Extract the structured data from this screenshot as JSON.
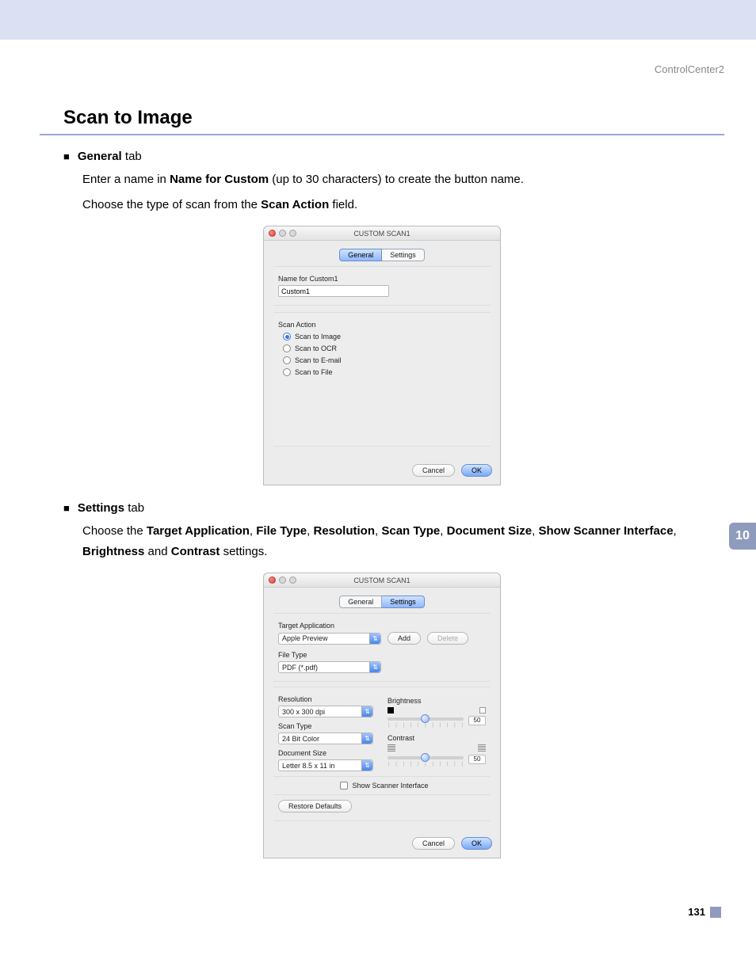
{
  "breadcrumb": "ControlCenter2",
  "section_title": "Scan to Image",
  "chapter_number": "10",
  "page_number": "131",
  "general": {
    "heading_bold": "General",
    "heading_rest": " tab",
    "line1_a": "Enter a name in ",
    "line1_b": "Name for Custom",
    "line1_c": " (up to 30 characters) to create the button name.",
    "line2_a": "Choose the type of scan from the ",
    "line2_b": "Scan Action",
    "line2_c": " field."
  },
  "settings": {
    "heading_bold": "Settings",
    "heading_rest": " tab",
    "line1_parts": {
      "a": "Choose the ",
      "b": "Target Application",
      "c": ", ",
      "d": "File Type",
      "e": ", ",
      "f": "Resolution",
      "g": ", ",
      "h": "Scan Type",
      "i": ", ",
      "j": "Document Size",
      "k": ", ",
      "l": "Show Scanner Interface",
      "m": ", ",
      "n": "Brightness",
      "o": " and ",
      "p": "Contrast",
      "q": " settings."
    }
  },
  "dialog1": {
    "title": "CUSTOM SCAN1",
    "tab_general": "General",
    "tab_settings": "Settings",
    "name_label": "Name for Custom1",
    "name_value": "Custom1",
    "scan_action_label": "Scan Action",
    "opt_image": "Scan to Image",
    "opt_ocr": "Scan to OCR",
    "opt_email": "Scan to E-mail",
    "opt_file": "Scan to File",
    "cancel": "Cancel",
    "ok": "OK"
  },
  "dialog2": {
    "title": "CUSTOM SCAN1",
    "tab_general": "General",
    "tab_settings": "Settings",
    "target_app_label": "Target Application",
    "target_app_value": "Apple Preview",
    "add": "Add",
    "delete": "Delete",
    "file_type_label": "File Type",
    "file_type_value": "PDF (*.pdf)",
    "resolution_label": "Resolution",
    "resolution_value": "300 x 300 dpi",
    "scan_type_label": "Scan Type",
    "scan_type_value": "24 Bit Color",
    "doc_size_label": "Document Size",
    "doc_size_value": "Letter  8.5 x 11 in",
    "brightness_label": "Brightness",
    "brightness_value": "50",
    "contrast_label": "Contrast",
    "contrast_value": "50",
    "show_scanner": "Show Scanner Interface",
    "restore": "Restore Defaults",
    "cancel": "Cancel",
    "ok": "OK"
  }
}
